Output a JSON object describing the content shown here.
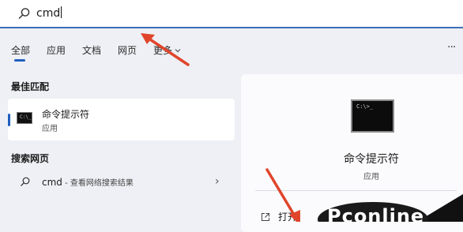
{
  "search": {
    "query": "cmd"
  },
  "tabs": [
    {
      "label": "全部",
      "active": true
    },
    {
      "label": "应用"
    },
    {
      "label": "文档"
    },
    {
      "label": "网页"
    },
    {
      "label": "更多"
    }
  ],
  "more_button": "···",
  "best_match": {
    "section_title": "最佳匹配",
    "name": "命令提示符",
    "type": "应用",
    "icon": "command-prompt-icon"
  },
  "web_search": {
    "section_title": "搜索网页",
    "query": "cmd",
    "suffix": " - 查看网络搜索结果"
  },
  "preview": {
    "name": "命令提示符",
    "type": "应用",
    "open_label": "打开"
  },
  "watermark": {
    "text": "Pconline"
  },
  "colors": {
    "accent": "#1f5fbf",
    "annotation": "#e0452c"
  }
}
